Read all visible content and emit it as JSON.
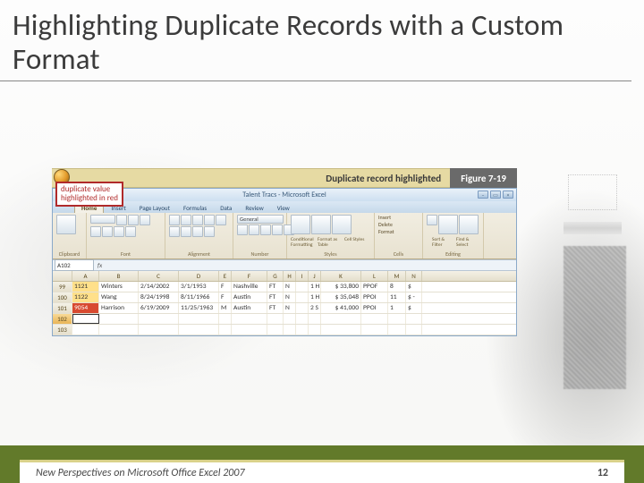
{
  "title": "Highlighting Duplicate Records with a Custom Format",
  "figure": {
    "caption": "Duplicate record highlighted",
    "number": "Figure  7-19"
  },
  "callout": {
    "line1": "duplicate value",
    "line2": "highlighted in red"
  },
  "excel": {
    "app_title": "Talent Tracs - Microsoft Excel",
    "tabs": [
      "Home",
      "Insert",
      "Page Layout",
      "Formulas",
      "Data",
      "Review",
      "View"
    ],
    "active_tab_index": 0,
    "groups": [
      "Clipboard",
      "Font",
      "Alignment",
      "Number",
      "Styles",
      "Cells",
      "Editing"
    ],
    "number_format": "General",
    "styles_btns": [
      "Conditional Formatting",
      "Format as Table",
      "Cell Styles"
    ],
    "cells_btns": [
      "Insert",
      "Delete",
      "Format"
    ],
    "editing_btns": [
      "Sort & Filter",
      "Find & Select"
    ],
    "name_box": "A102",
    "columns": [
      "A",
      "B",
      "C",
      "D",
      "E",
      "F",
      "G",
      "H",
      "I",
      "J",
      "K",
      "L",
      "M",
      "N"
    ],
    "rows": [
      {
        "n": "99",
        "a": "1121",
        "b": "Winters",
        "c": "2/14/2002",
        "d": "3/1/1953",
        "e": "F",
        "f": "Nashville",
        "g": "FT",
        "h": "N",
        "i": "",
        "j": "1",
        "k": "H",
        "l": "$  33,800",
        "m": "PPOF",
        "n2": "8",
        "o": "$"
      },
      {
        "n": "100",
        "a": "1122",
        "b": "Wang",
        "c": "8/24/1998",
        "d": "8/11/1966",
        "e": "F",
        "f": "Austin",
        "g": "FT",
        "h": "N",
        "i": "",
        "j": "1",
        "k": "H",
        "l": "$  35,048",
        "m": "PPOI",
        "n2": "11",
        "o": "$  -"
      },
      {
        "n": "101",
        "a": "9054",
        "b": "Harrison",
        "c": "6/19/2009",
        "d": "11/25/1963",
        "e": "M",
        "f": "Austin",
        "g": "FT",
        "h": "N",
        "i": "",
        "j": "2",
        "k": "S",
        "l": "$  41,000",
        "m": "PPOI",
        "n2": "1",
        "o": "$"
      },
      {
        "n": "102",
        "a": "",
        "b": "",
        "c": "",
        "d": "",
        "e": "",
        "f": "",
        "g": "",
        "h": "",
        "i": "",
        "j": "",
        "k": "",
        "l": "",
        "m": "",
        "n2": "",
        "o": ""
      },
      {
        "n": "103",
        "a": "",
        "b": "",
        "c": "",
        "d": "",
        "e": "",
        "f": "",
        "g": "",
        "h": "",
        "i": "",
        "j": "",
        "k": "",
        "l": "",
        "m": "",
        "n2": "",
        "o": ""
      }
    ],
    "highlight": {
      "yellow_rows": [
        0,
        1
      ],
      "red_cell_row": 2,
      "selected_row": 3
    }
  },
  "footer": {
    "text": "New Perspectives on Microsoft Office Excel 2007",
    "page": "12"
  }
}
